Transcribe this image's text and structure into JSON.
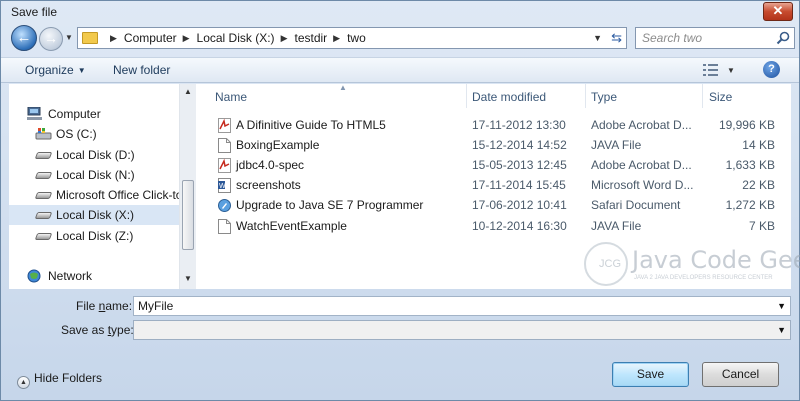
{
  "window": {
    "title": "Save file",
    "close_glyph": "✕"
  },
  "nav": {
    "back_glyph": "←",
    "forward_glyph": "→",
    "breadcrumbs": [
      "Computer",
      "Local Disk (X:)",
      "testdir",
      "two"
    ],
    "search_placeholder": "Search two"
  },
  "toolbar": {
    "organize_label": "Organize",
    "new_folder_label": "New folder",
    "help_glyph": "?"
  },
  "sidebar": {
    "items": [
      {
        "label": "Computer",
        "icon": "computer-icon",
        "selected": false
      },
      {
        "label": "OS (C:)",
        "icon": "drive-icon",
        "selected": false
      },
      {
        "label": "Local Disk (D:)",
        "icon": "drive-icon",
        "selected": false
      },
      {
        "label": "Local Disk (N:)",
        "icon": "drive-icon",
        "selected": false
      },
      {
        "label": "Microsoft Office Click-to",
        "icon": "drive-icon",
        "selected": false
      },
      {
        "label": "Local Disk (X:)",
        "icon": "drive-icon",
        "selected": true
      },
      {
        "label": "Local Disk (Z:)",
        "icon": "drive-icon",
        "selected": false
      },
      {
        "label": "Network",
        "icon": "network-icon",
        "selected": false
      }
    ]
  },
  "files": {
    "columns": {
      "name": "Name",
      "date": "Date modified",
      "type": "Type",
      "size": "Size"
    },
    "rows": [
      {
        "name": "A Difinitive Guide To HTML5",
        "date": "17-11-2012 13:30",
        "type": "Adobe Acrobat D...",
        "size": "19,996 KB",
        "icon": "pdf-icon"
      },
      {
        "name": "BoxingExample",
        "date": "15-12-2014 14:52",
        "type": "JAVA File",
        "size": "14 KB",
        "icon": "file-icon"
      },
      {
        "name": "jdbc4.0-spec",
        "date": "15-05-2013 12:45",
        "type": "Adobe Acrobat D...",
        "size": "1,633 KB",
        "icon": "pdf-icon"
      },
      {
        "name": "screenshots",
        "date": "17-11-2014 15:45",
        "type": "Microsoft Word D...",
        "size": "22 KB",
        "icon": "word-icon"
      },
      {
        "name": "Upgrade to Java SE 7 Programmer",
        "date": "17-06-2012 10:41",
        "type": "Safari Document",
        "size": "1,272 KB",
        "icon": "safari-icon"
      },
      {
        "name": "WatchEventExample",
        "date": "10-12-2014 16:30",
        "type": "JAVA File",
        "size": "7 KB",
        "icon": "file-icon"
      }
    ]
  },
  "watermark": {
    "title": "Java Code Geeks",
    "subtitle": "JAVA 2 JAVA DEVELOPERS RESOURCE CENTER",
    "logo_text": "JCG"
  },
  "form": {
    "file_name_label_pre": "File ",
    "file_name_label_u": "n",
    "file_name_label_post": "ame:",
    "file_name_value": "MyFile",
    "save_type_label_pre": "Save as ",
    "save_type_label_u": "t",
    "save_type_label_post": "ype:",
    "save_type_value": ""
  },
  "footer": {
    "hide_folders_label": "Hide Folders",
    "save_label": "Save",
    "cancel_label": "Cancel"
  },
  "colors": {
    "selected": "#d9e6f5",
    "accent": "#2e6fb8",
    "close": "#c74b2f"
  }
}
